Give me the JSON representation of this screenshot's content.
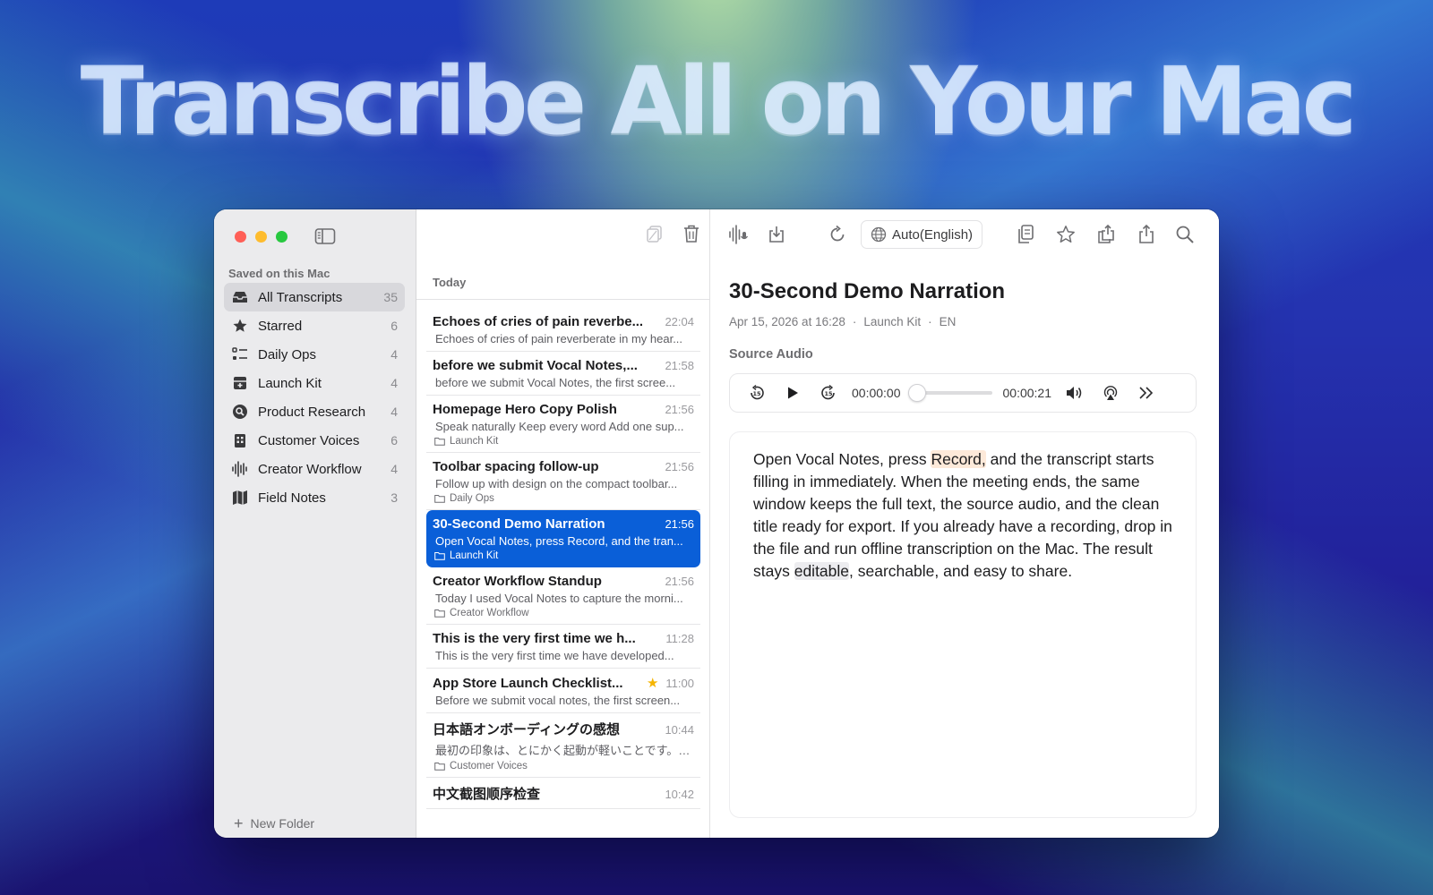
{
  "hero": {
    "title": "Transcribe All on Your Mac"
  },
  "sidebar": {
    "section_label": "Saved on this Mac",
    "items": [
      {
        "label": "All Transcripts",
        "count": "35",
        "icon": "tray-icon"
      },
      {
        "label": "Starred",
        "count": "6",
        "icon": "star-icon"
      },
      {
        "label": "Daily Ops",
        "count": "4",
        "icon": "list-icon"
      },
      {
        "label": "Launch Kit",
        "count": "4",
        "icon": "archive-box-icon"
      },
      {
        "label": "Product Research",
        "count": "4",
        "icon": "search-circle-icon"
      },
      {
        "label": "Customer Voices",
        "count": "6",
        "icon": "building-icon"
      },
      {
        "label": "Creator Workflow",
        "count": "4",
        "icon": "waveform-icon"
      },
      {
        "label": "Field Notes",
        "count": "3",
        "icon": "map-icon"
      }
    ],
    "new_folder": "New Folder"
  },
  "list": {
    "header": "Today",
    "rows": [
      {
        "title": "Echoes of cries of pain reverbe...",
        "time": "22:04",
        "snippet": "Echoes of cries of pain reverberate in my hear...",
        "folder": ""
      },
      {
        "title": "before we submit Vocal Notes,...",
        "time": "21:58",
        "snippet": "before we submit Vocal Notes, the first scree...",
        "folder": ""
      },
      {
        "title": "Homepage Hero Copy Polish",
        "time": "21:56",
        "snippet": "Speak naturally Keep every word Add one sup...",
        "folder": "Launch Kit"
      },
      {
        "title": "Toolbar spacing follow-up",
        "time": "21:56",
        "snippet": "Follow up with design on the compact toolbar...",
        "folder": "Daily Ops"
      },
      {
        "title": "30-Second Demo Narration",
        "time": "21:56",
        "snippet": "Open Vocal Notes, press Record, and the tran...",
        "folder": "Launch Kit",
        "selected": true
      },
      {
        "title": "Creator Workflow Standup",
        "time": "21:56",
        "snippet": "Today I used Vocal Notes to capture the morni...",
        "folder": "Creator Workflow"
      },
      {
        "title": "This is the very first time we h...",
        "time": "11:28",
        "snippet": "This is the very first time we have developed...",
        "folder": ""
      },
      {
        "title": "App Store Launch Checklist...",
        "time": "11:00",
        "snippet": "Before we submit vocal notes, the first screen...",
        "folder": "",
        "starred": true
      },
      {
        "title": "日本語オンボーディングの感想",
        "time": "10:44",
        "snippet": "最初の印象は、とにかく起動が軽いことです。メ...",
        "folder": "Customer Voices"
      },
      {
        "title": "中文截图顺序检查",
        "time": "10:42",
        "snippet": "",
        "folder": ""
      }
    ]
  },
  "detail": {
    "language": "Auto(English)",
    "title": "30-Second Demo Narration",
    "date": "Apr 15, 2026 at 16:28",
    "folder": "Launch Kit",
    "lang_code": "EN",
    "sep": "·",
    "source_label": "Source Audio",
    "player": {
      "current": "00:00:00",
      "duration": "00:00:21",
      "progress": 0
    },
    "body": {
      "p1": "Open Vocal Notes, press ",
      "hl1": "Record,",
      "p2": " and the transcript starts filling in immediately. When the meeting ends, the same window keeps the full text, the source audio, and the clean title ready for export. If you already have a recording, drop in the file and run offline transcription on the Mac. The result stays ",
      "hl2": "editable",
      "p3": ", searchable, and easy to share."
    }
  },
  "colors": {
    "accent": "#0a5fd8",
    "star": "#f5b400",
    "sidebar_bg": "#ebebed"
  }
}
